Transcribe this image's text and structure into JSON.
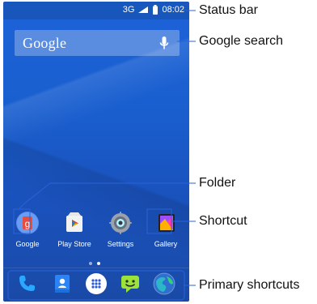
{
  "status_bar": {
    "network_label": "3G",
    "signal_label": "",
    "time": "08:02"
  },
  "search": {
    "logo": "Google"
  },
  "apps": [
    {
      "label": "Google"
    },
    {
      "label": "Play Store"
    },
    {
      "label": "Settings"
    },
    {
      "label": "Gallery"
    }
  ],
  "dock": {
    "items": [
      {
        "name": "phone"
      },
      {
        "name": "contacts"
      },
      {
        "name": "apps"
      },
      {
        "name": "messages"
      },
      {
        "name": "browser"
      }
    ]
  },
  "callouts": {
    "status_bar": "Status bar",
    "google_search": "Google search",
    "folder": "Folder",
    "shortcut": "Shortcut",
    "primary_shortcuts": "Primary shortcuts"
  },
  "colors": {
    "wallpaper_top": "#1c63d8",
    "wallpaper_bottom": "#1a4aa7",
    "callout_line": "#2a63d9",
    "text_dark": "#111111"
  },
  "icons": {
    "mic": "microphone-icon",
    "battery": "battery-icon",
    "signal": "signal-icon",
    "google_folder": "google-folder-icon",
    "play_store": "play-store-icon",
    "settings": "settings-gear-icon",
    "gallery": "gallery-icon",
    "phone": "phone-icon",
    "contacts": "contacts-icon",
    "apps": "app-drawer-icon",
    "messages": "messages-icon",
    "browser": "browser-icon"
  }
}
